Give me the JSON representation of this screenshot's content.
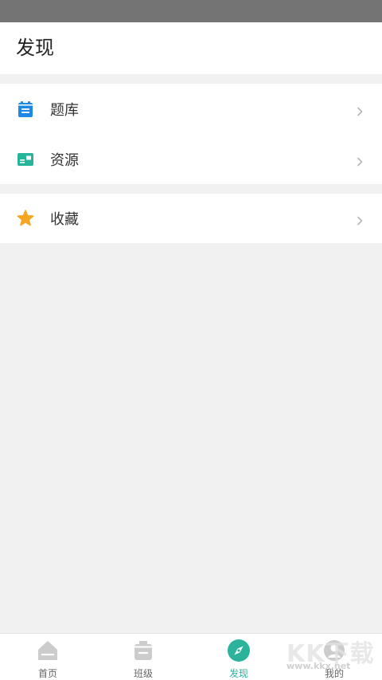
{
  "header": {
    "title": "发现"
  },
  "menu_groups": [
    {
      "items": [
        {
          "label": "题库",
          "icon": "question-bank-icon",
          "color": "#1e88e5"
        },
        {
          "label": "资源",
          "icon": "resource-card-icon",
          "color": "#26b49a"
        }
      ]
    },
    {
      "items": [
        {
          "label": "收藏",
          "icon": "star-icon",
          "color": "#f5a623"
        }
      ]
    }
  ],
  "bottom_nav": {
    "items": [
      {
        "label": "首页",
        "icon": "home-icon",
        "active": false
      },
      {
        "label": "班级",
        "icon": "class-icon",
        "active": false
      },
      {
        "label": "发现",
        "icon": "compass-icon",
        "active": true
      },
      {
        "label": "我的",
        "icon": "profile-icon",
        "active": false
      }
    ]
  },
  "watermark": {
    "brand": "KK下载",
    "site": "www.kkx.net"
  },
  "colors": {
    "accent": "#2bb39b",
    "status_bar": "#747474",
    "background": "#f1f1f1",
    "nav_icon_inactive": "#cccccc"
  }
}
